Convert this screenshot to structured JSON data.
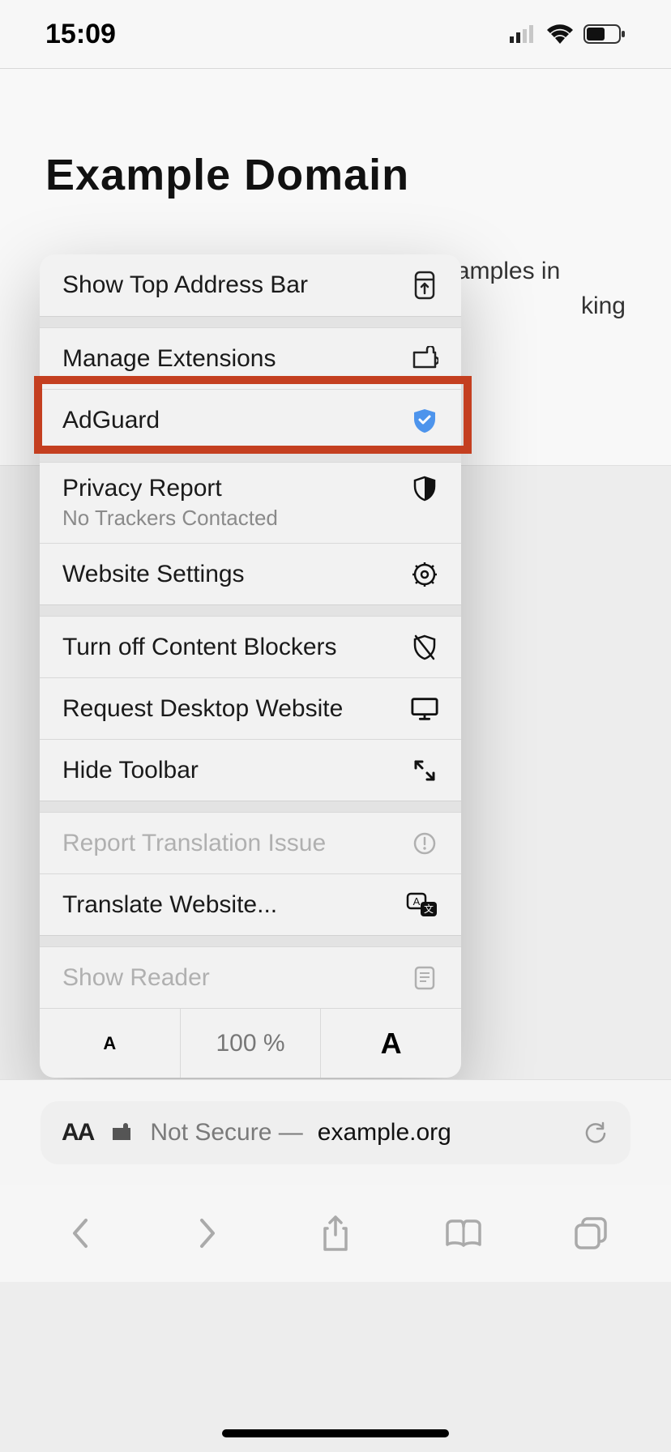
{
  "status": {
    "time": "15:09"
  },
  "page": {
    "title": "Example Domain",
    "text": "This domain is for use in illustrative examples in",
    "peek": "king"
  },
  "menu": {
    "show_top": "Show Top Address Bar",
    "manage_ext": "Manage Extensions",
    "adguard": "AdGuard",
    "privacy": "Privacy Report",
    "privacy_sub": "No Trackers Contacted",
    "website_settings": "Website Settings",
    "turn_off_blockers": "Turn off Content Blockers",
    "request_desktop": "Request Desktop Website",
    "hide_toolbar": "Hide Toolbar",
    "report_translation": "Report Translation Issue",
    "translate": "Translate Website...",
    "show_reader": "Show Reader",
    "zoom_small": "A",
    "zoom_pct": "100 %",
    "zoom_big": "A"
  },
  "addressbar": {
    "aa": "AA",
    "not_secure": "Not Secure — ",
    "host": "example.org"
  }
}
